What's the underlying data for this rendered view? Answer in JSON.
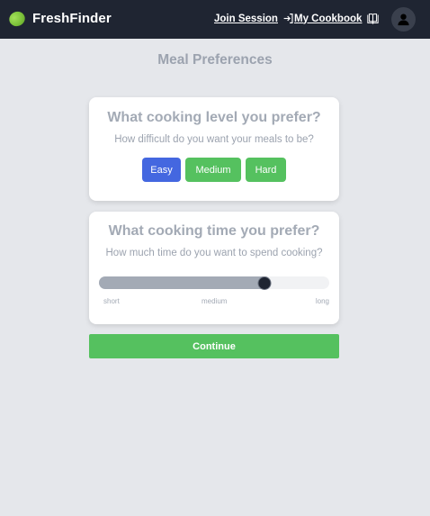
{
  "brand": {
    "name": "FreshFinder",
    "logo_icon": "lime-icon"
  },
  "nav": {
    "join_session": "Join Session",
    "join_icon": "login-arrow-icon",
    "my_cookbook": "My Cookbook",
    "cookbook_icon": "open-book-icon",
    "avatar_icon": "user-avatar-icon"
  },
  "page": {
    "title": "Meal Preferences"
  },
  "level_card": {
    "title": "What cooking level you prefer?",
    "subtitle": "How difficult do you want your meals to be?",
    "options": [
      "Easy",
      "Medium",
      "Hard"
    ],
    "selected": "Easy"
  },
  "time_card": {
    "title": "What cooking time you prefer?",
    "subtitle": "How much time do you want to spend cooking?",
    "slider_value": 0.72,
    "labels": {
      "short": "short",
      "medium": "medium",
      "long": "long"
    }
  },
  "continue_label": "Continue",
  "colors": {
    "navbar": "#1f2532",
    "selected_button": "#4467e0",
    "button": "#55c15f",
    "muted_text": "#9ca3af"
  }
}
